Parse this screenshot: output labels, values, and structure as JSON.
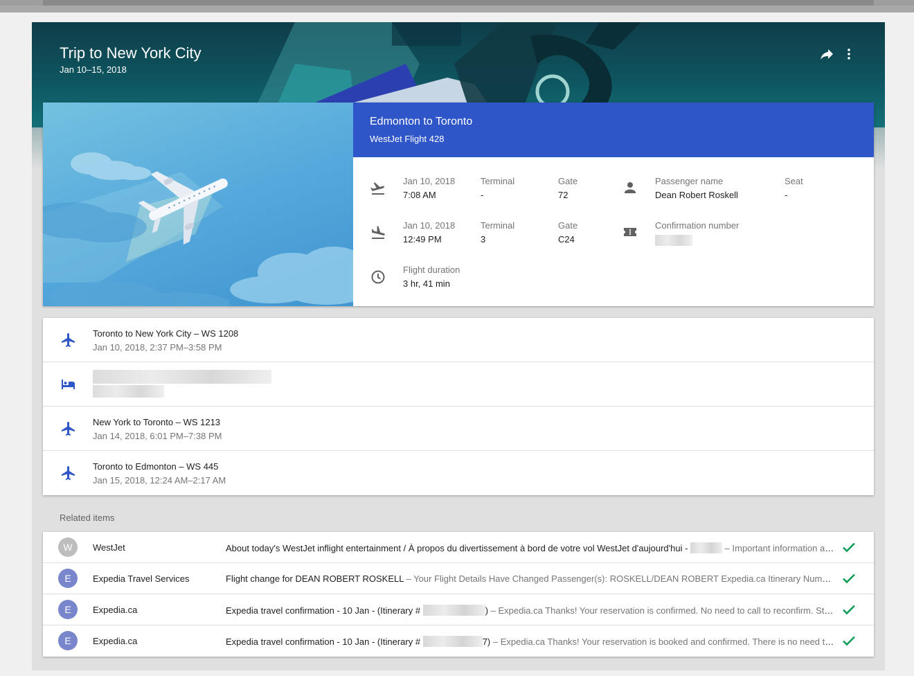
{
  "trip": {
    "title": "Trip to New York City",
    "dates": "Jan 10–15, 2018"
  },
  "hero_actions": {
    "share_icon": "share-icon",
    "more_icon": "more-vert-icon"
  },
  "flight": {
    "route": "Edmonton to Toronto",
    "flight": "WestJet Flight 428",
    "departure": {
      "date": "Jan 10, 2018",
      "time": "7:08 AM",
      "terminal_label": "Terminal",
      "terminal": "-",
      "gate_label": "Gate",
      "gate": "72"
    },
    "arrival": {
      "date": "Jan 10, 2018",
      "time": "12:49 PM",
      "terminal_label": "Terminal",
      "terminal": "3",
      "gate_label": "Gate",
      "gate": "C24"
    },
    "duration_label": "Flight duration",
    "duration": "3 hr, 41 min",
    "passenger_label": "Passenger name",
    "passenger": "Dean Robert Roskell",
    "seat_label": "Seat",
    "seat": "-",
    "confirmation_label": "Confirmation number"
  },
  "legs": [
    {
      "icon": "airplane-icon",
      "title": "Toronto to New York City – WS 1208",
      "sub": "Jan 10, 2018, 2:37 PM–3:58 PM"
    },
    {
      "icon": "hotel-icon",
      "title": "",
      "sub": ""
    },
    {
      "icon": "airplane-icon",
      "title": "New York to Toronto – WS 1213",
      "sub": "Jan 14, 2018, 6:01 PM–7:38 PM"
    },
    {
      "icon": "airplane-icon",
      "title": "Toronto to Edmonton – WS 445",
      "sub": "Jan 15, 2018, 12:24 AM–2:17 AM"
    }
  ],
  "related_label": "Related items",
  "related": [
    {
      "initial": "W",
      "avatar_color": "#bdbdbd",
      "sender": "WestJet",
      "subject": "About today's WestJet inflight entertainment / À propos du divertissement à bord de votre vol WestJet d'aujourd'hui -",
      "subject_tail": "",
      "snippet": " – Important information about your flight today WestJet"
    },
    {
      "initial": "E",
      "avatar_color": "#7986cb",
      "sender": "Expedia Travel Services",
      "subject": "Flight change for DEAN ROBERT ROSKELL",
      "subject_tail": "",
      "snippet": " – Your Flight Details Have Changed Passenger(s): ROSKELL/DEAN ROBERT Expedia.ca Itinerary Number"
    },
    {
      "initial": "E",
      "avatar_color": "#7986cb",
      "sender": "Expedia.ca",
      "subject": "Expedia travel confirmation - 10 Jan - (Itinerary #",
      "subject_tail": ")",
      "snippet": " – Expedia.ca Thanks! Your reservation is confirmed. No need to call to reconfirm. Steps"
    },
    {
      "initial": "E",
      "avatar_color": "#7986cb",
      "sender": "Expedia.ca",
      "subject": "Expedia travel confirmation - 10 Jan - (Itinerary #",
      "subject_tail": "7)",
      "snippet": " – Expedia.ca Thanks! Your reservation is booked and confirmed. There is no need to call"
    }
  ],
  "colors": {
    "accent_blue": "#2f56c8",
    "icon_blue": "#2f56c8",
    "check_green": "#0f9d58",
    "hero_teal": "#0e5560"
  }
}
